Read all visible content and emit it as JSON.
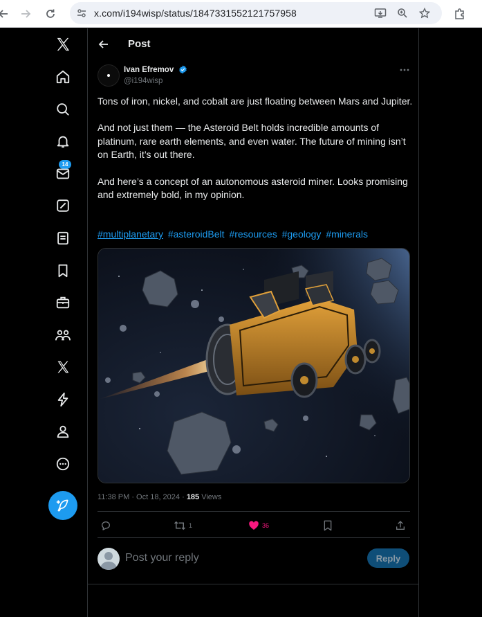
{
  "browser": {
    "url": "x.com/i194wisp/status/1847331552121757958"
  },
  "sidebar": {
    "notification_count": "14",
    "items": [
      "x-logo",
      "home-icon",
      "search-icon",
      "bell-icon",
      "mail-icon",
      "grok-icon",
      "lists-icon",
      "bookmark-icon",
      "jobs-icon",
      "communities-icon",
      "premium-x-icon",
      "verified-orgs-icon",
      "profile-icon",
      "more-icon"
    ]
  },
  "header": {
    "title": "Post"
  },
  "post": {
    "author_name": "Ivan Efremov",
    "handle": "@i194wisp",
    "paragraphs": [
      "Tons of iron, nickel, and cobalt are just floating between Mars and Jupiter.",
      "And not just them — the Asteroid Belt holds incredible amounts of platinum, rare earth elements, and even water. The future of mining isn’t on Earth, it’s out there.",
      "And here’s a concept of an autonomous asteroid miner. Looks promising and extremely bold, in my opinion."
    ],
    "hashtags": [
      "#multiplanetary",
      "#asteroidBelt",
      "#resources",
      "#geology",
      "#minerals"
    ],
    "timestamp": "11:38 PM · Oct 18, 2024 · ",
    "views_count": "185",
    "views_label": " Views",
    "retweets": "1",
    "likes": "36"
  },
  "reply": {
    "placeholder": "Post your reply",
    "button": "Reply"
  },
  "colors": {
    "accent": "#1d9bf0",
    "like": "#f91880",
    "background": "#000000"
  }
}
